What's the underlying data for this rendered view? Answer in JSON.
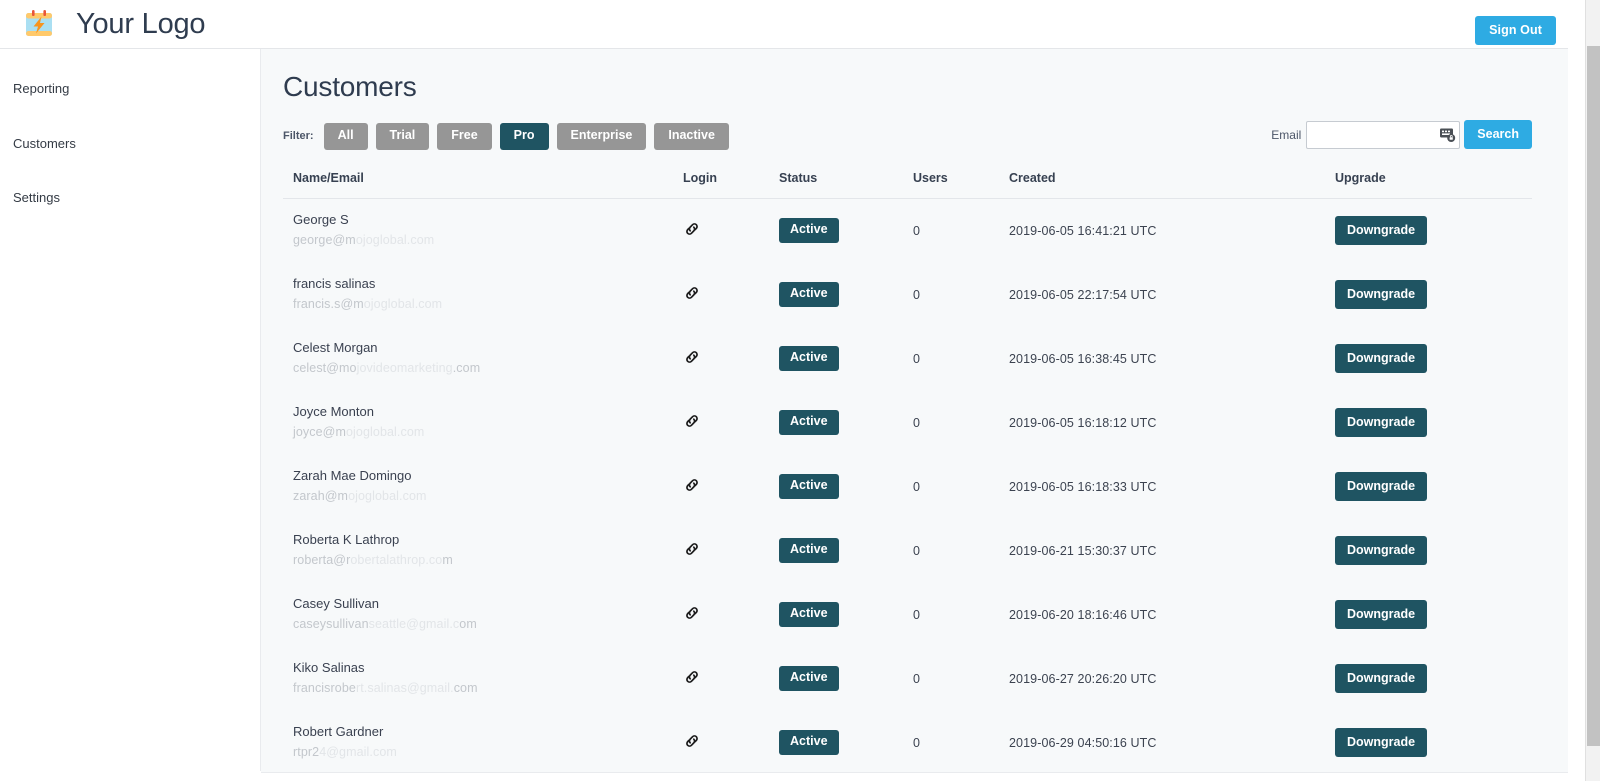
{
  "header": {
    "logo_icon": "calendar-bolt-icon",
    "logo_text": "Your Logo",
    "sign_out_label": "Sign Out"
  },
  "sidebar": {
    "items": [
      {
        "label": "Reporting",
        "name": "reporting"
      },
      {
        "label": "Customers",
        "name": "customers"
      },
      {
        "label": "Settings",
        "name": "settings"
      }
    ]
  },
  "main": {
    "page_title": "Customers",
    "filter_label": "Filter:",
    "filters": [
      {
        "label": "All",
        "active": false
      },
      {
        "label": "Trial",
        "active": false
      },
      {
        "label": "Free",
        "active": false
      },
      {
        "label": "Pro",
        "active": true
      },
      {
        "label": "Enterprise",
        "active": false
      },
      {
        "label": "Inactive",
        "active": false
      }
    ],
    "search": {
      "email_label": "Email",
      "email_value": "",
      "email_placeholder": "",
      "autofill_icon": "form-autofill-icon",
      "search_button_label": "Search"
    },
    "table": {
      "columns": [
        "Name/Email",
        "Login",
        "Status",
        "Users",
        "Created",
        "Upgrade"
      ],
      "login_icon": "chain-link-icon",
      "rows": [
        {
          "name": "George S",
          "email_visible": "george@m",
          "email_dim": "ojoglobal.com",
          "status": "Active",
          "users": "0",
          "created": "2019-06-05 16:41:21 UTC",
          "action": "Downgrade"
        },
        {
          "name": "francis salinas",
          "email_visible": "francis.s@m",
          "email_dim": "ojoglobal.com",
          "status": "Active",
          "users": "0",
          "created": "2019-06-05 22:17:54 UTC",
          "action": "Downgrade"
        },
        {
          "name": "Celest Morgan",
          "email_visible": "celest@mo",
          "email_dim": "jovideomarketing",
          "email_tail": ".com",
          "status": "Active",
          "users": "0",
          "created": "2019-06-05 16:38:45 UTC",
          "action": "Downgrade"
        },
        {
          "name": "Joyce Monton",
          "email_visible": "joyce@m",
          "email_dim": "ojoglobal.com",
          "status": "Active",
          "users": "0",
          "created": "2019-06-05 16:18:12 UTC",
          "action": "Downgrade"
        },
        {
          "name": "Zarah Mae Domingo",
          "email_visible": "zarah@m",
          "email_dim": "ojoglobal.com",
          "status": "Active",
          "users": "0",
          "created": "2019-06-05 16:18:33 UTC",
          "action": "Downgrade"
        },
        {
          "name": "Roberta K Lathrop",
          "email_visible": "roberta@r",
          "email_dim": "obertalathrop.co",
          "email_tail": "m",
          "status": "Active",
          "users": "0",
          "created": "2019-06-21 15:30:37 UTC",
          "action": "Downgrade"
        },
        {
          "name": "Casey Sullivan",
          "email_visible": "caseysullivan",
          "email_dim": "seattle@gmail.c",
          "email_tail": "om",
          "status": "Active",
          "users": "0",
          "created": "2019-06-20 18:16:46 UTC",
          "action": "Downgrade"
        },
        {
          "name": "Kiko Salinas",
          "email_visible": "francisrobe",
          "email_dim": "rt.salinas@gmail.",
          "email_tail": "com",
          "status": "Active",
          "users": "0",
          "created": "2019-06-27 20:26:20 UTC",
          "action": "Downgrade"
        },
        {
          "name": "Robert Gardner",
          "email_visible": "rtpr2",
          "email_dim": "4@gmail.com",
          "status": "Active",
          "users": "0",
          "created": "2019-06-29 04:50:16 UTC",
          "action": "Downgrade"
        }
      ]
    }
  },
  "colors": {
    "accent_blue": "#2eabe3",
    "dark_teal": "#1f5462",
    "filter_grey": "#969696",
    "page_bg": "#f7f9fa",
    "text_dark": "#2f3c4f"
  }
}
